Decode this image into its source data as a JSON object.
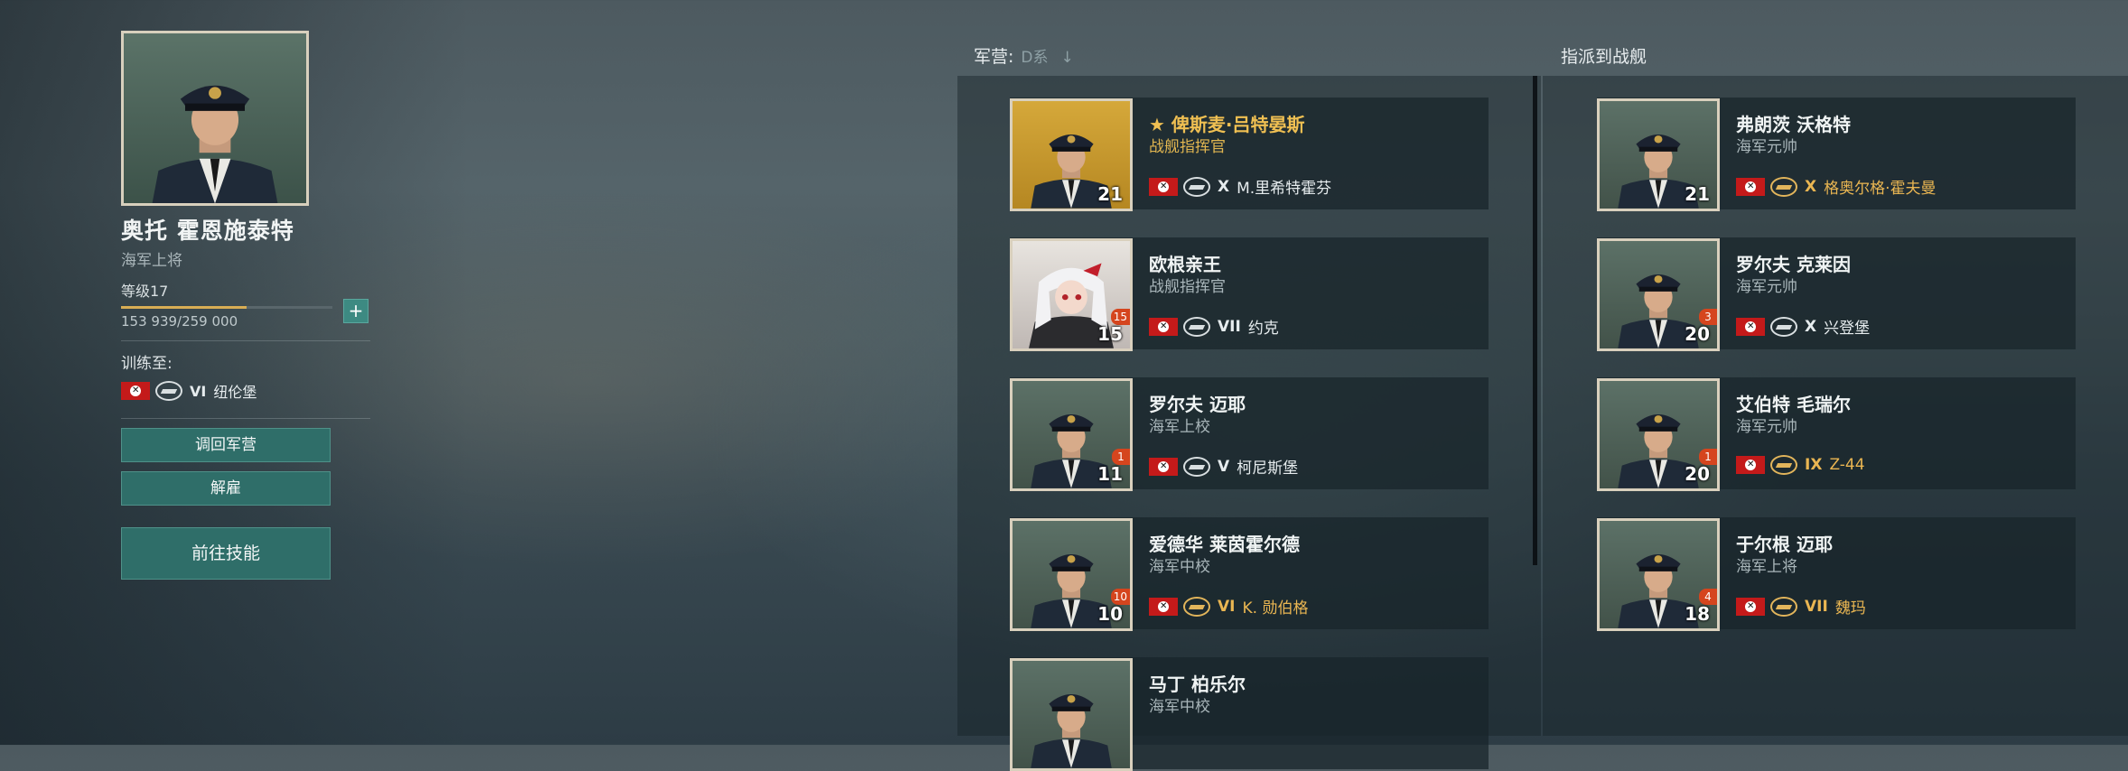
{
  "selected": {
    "name": "奥托 霍恩施泰特",
    "rank": "海军上将",
    "level": "等级17",
    "xp_text": "153 939/259 000",
    "xp_progress": 0.594,
    "plus_label": "+",
    "trained_label": "训练至:",
    "trained_ship": {
      "tier": "VI",
      "name": "纽伦堡"
    },
    "buttons": {
      "return": "调回军营",
      "dismiss": "解雇",
      "skills": "前往技能"
    }
  },
  "barracks": {
    "label": "军营:",
    "filter": "D系",
    "sort_icon": "↓",
    "commanders": [
      {
        "name": "★ 俾斯麦·吕特晏斯",
        "rank": "战舰指挥官",
        "special": true,
        "level": "21",
        "badge": "",
        "portrait": "gold",
        "ship_tier": "X",
        "ship_name": "M.里希特霍芬",
        "ship_gold": false
      },
      {
        "name": "欧根亲王",
        "rank": "战舰指挥官",
        "special": false,
        "level": "15",
        "badge": "15",
        "portrait": "anime",
        "ship_tier": "VII",
        "ship_name": "约克",
        "ship_gold": false
      },
      {
        "name": "罗尔夫 迈耶",
        "rank": "海军上校",
        "special": false,
        "level": "11",
        "badge": "1",
        "portrait": "std",
        "ship_tier": "V",
        "ship_name": "柯尼斯堡",
        "ship_gold": false
      },
      {
        "name": "爱德华 莱茵霍尔德",
        "rank": "海军中校",
        "special": false,
        "level": "10",
        "badge": "10",
        "portrait": "std",
        "ship_tier": "VI",
        "ship_name": "K. 勋伯格",
        "ship_gold": true
      },
      {
        "name": "马丁 柏乐尔",
        "rank": "海军中校",
        "special": false,
        "level": "",
        "badge": "",
        "portrait": "std",
        "ship_tier": "",
        "ship_name": "",
        "ship_gold": false
      }
    ]
  },
  "assigned": {
    "label": "指派到战舰",
    "commanders": [
      {
        "name": "弗朗茨 沃格特",
        "rank": "海军元帅",
        "level": "21",
        "badge": "",
        "ship_tier": "X",
        "ship_name": "格奥尔格·霍夫曼",
        "ship_gold": true
      },
      {
        "name": "罗尔夫 克莱因",
        "rank": "海军元帅",
        "level": "20",
        "badge": "3",
        "ship_tier": "X",
        "ship_name": "兴登堡",
        "ship_gold": false
      },
      {
        "name": "艾伯特 毛瑞尔",
        "rank": "海军元帅",
        "level": "20",
        "badge": "1",
        "ship_tier": "IX",
        "ship_name": "Z-44",
        "ship_gold": true
      },
      {
        "name": "于尔根 迈耶",
        "rank": "海军上将",
        "level": "18",
        "badge": "4",
        "ship_tier": "VII",
        "ship_name": "魏玛",
        "ship_gold": true
      }
    ]
  },
  "colors": {
    "accent_button": "#2f6e69",
    "gold": "#eab652",
    "badge": "#d5451e",
    "flag": "#c41a1a"
  }
}
